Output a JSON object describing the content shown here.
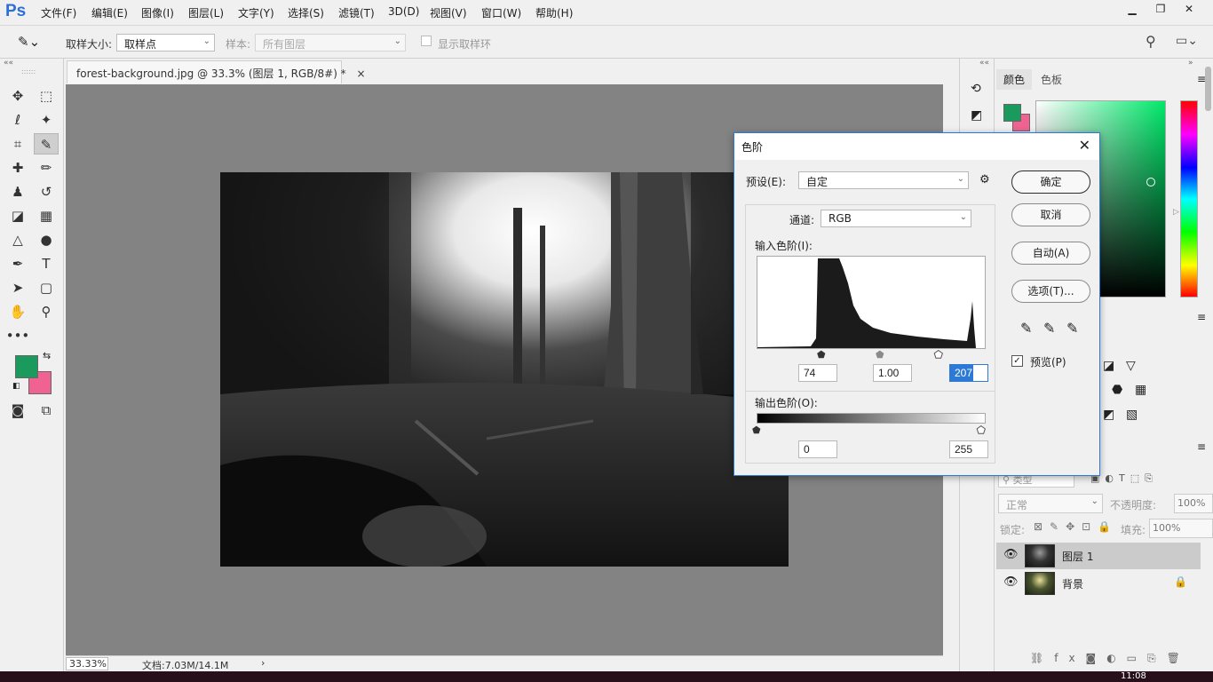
{
  "app": {
    "logo": "Ps",
    "menu": [
      "文件(F)",
      "编辑(E)",
      "图像(I)",
      "图层(L)",
      "文字(Y)",
      "选择(S)",
      "滤镜(T)",
      "3D(D)",
      "视图(V)",
      "窗口(W)",
      "帮助(H)"
    ],
    "window_controls": [
      "▁",
      "❐",
      "✕"
    ]
  },
  "options_bar": {
    "sample_size_label": "取样大小:",
    "sample_size_value": "取样点",
    "sample_label": "样本:",
    "sample_value": "所有图层",
    "show_ring_label": "显示取样环"
  },
  "document": {
    "tab_title": "forest-background.jpg @ 33.3% (图层 1, RGB/8#) *",
    "tab_close": "×",
    "zoom": "33.33%",
    "doc_info": "文档:7.03M/14.1M",
    "status_arrow": "›"
  },
  "colors": {
    "foreground": "#1a9a5c",
    "background": "#f06292",
    "accent": "#2d7ad6"
  },
  "color_panel": {
    "tabs": [
      "颜色",
      "色板"
    ],
    "active_tab": "颜色"
  },
  "layers_panel": {
    "filter_label": "类型",
    "blend_mode": "正常",
    "opacity_label": "不透明度:",
    "opacity_value": "100%",
    "lock_label": "锁定:",
    "fill_label": "填充:",
    "fill_value": "100%",
    "layers": [
      {
        "name": "图层 1",
        "selected": true,
        "visible": true,
        "locked": false
      },
      {
        "name": "背景",
        "selected": false,
        "visible": true,
        "locked": true
      }
    ]
  },
  "levels_dialog": {
    "title": "色阶",
    "preset_label": "预设(E):",
    "preset_value": "自定",
    "channel_label": "通道:",
    "channel_value": "RGB",
    "input_levels_label": "输入色阶(I):",
    "input_black": "74",
    "input_gamma": "1.00",
    "input_white": "207",
    "output_levels_label": "输出色阶(O):",
    "output_black": "0",
    "output_white": "255",
    "buttons": {
      "ok": "确定",
      "cancel": "取消",
      "auto": "自动(A)",
      "options": "选项(T)..."
    },
    "preview_label": "预览(P)",
    "preview_checked": true,
    "close": "✕"
  },
  "taskbar": {
    "clock": "11:08"
  }
}
